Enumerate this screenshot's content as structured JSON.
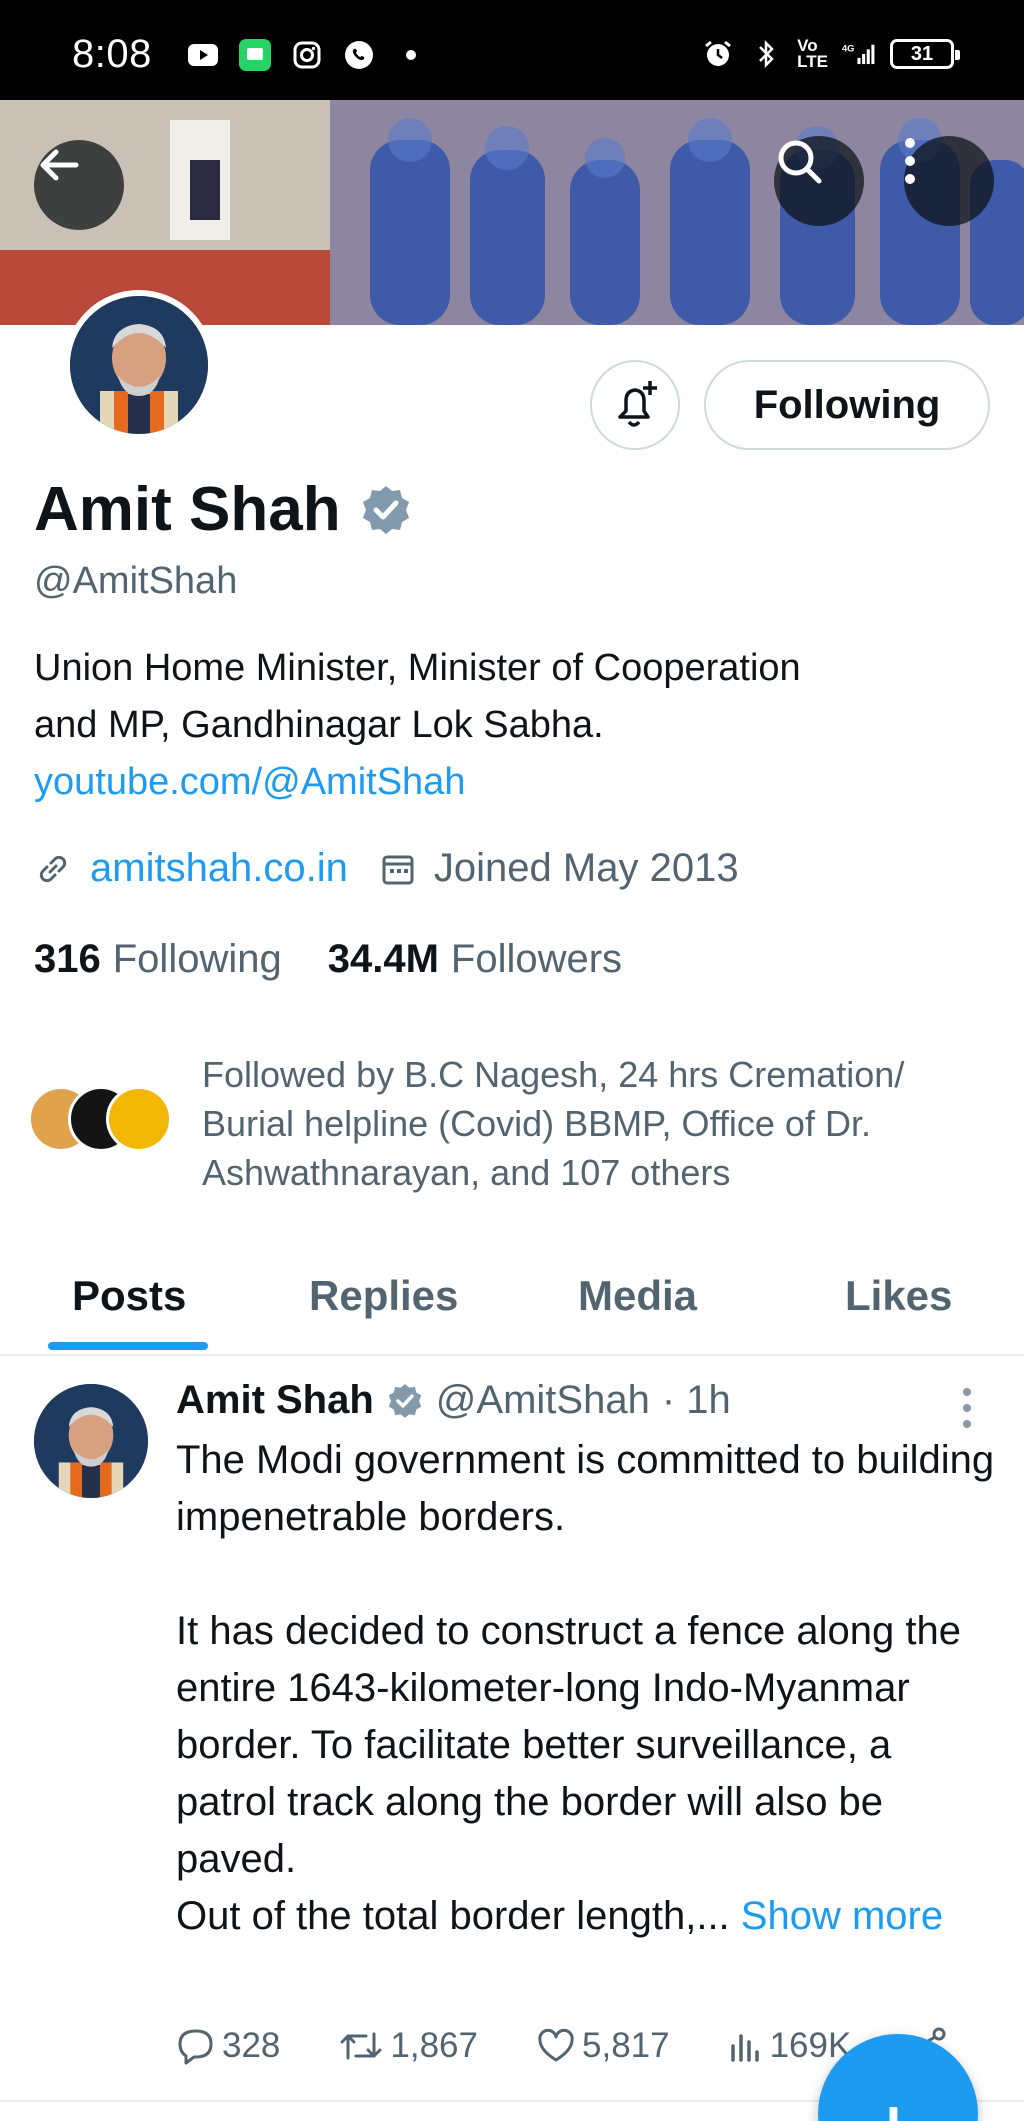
{
  "status_bar": {
    "time": "8:08",
    "battery": "31"
  },
  "header": {
    "back_icon": "arrow-left-icon",
    "search_icon": "search-icon",
    "more_icon": "more-vertical-icon"
  },
  "profile": {
    "name": "Amit Shah",
    "handle": "@AmitShah",
    "verified": true,
    "following_button": "Following",
    "bio_line1": "Union Home Minister, Minister of Cooperation",
    "bio_line2": "and MP, Gandhinagar Lok Sabha.",
    "bio_link": "youtube.com/@AmitShah",
    "website": "amitshah.co.in",
    "joined": "Joined May 2013",
    "following_count": "316",
    "following_label": "Following",
    "followers_count": "34.4M",
    "followers_label": "Followers",
    "followed_by": "Followed by B.C Nagesh, 24 hrs Cremation/ Burial helpline (Covid) BBMP, Office of Dr. Ashwathnarayan, and 107 others"
  },
  "tabs": [
    "Posts",
    "Replies",
    "Media",
    "Likes"
  ],
  "post": {
    "name": "Amit Shah",
    "handle": "@AmitShah",
    "time": "· 1h",
    "text": "The Modi government is committed to building impenetrable borders.\n\nIt has decided to construct a fence along the entire 1643-kilometer-long Indo-Myanmar border. To facilitate better surveillance, a patrol track along the border will also be paved.\nOut of the total border length,... ",
    "show_more": "Show more",
    "replies": "328",
    "reposts": "1,867",
    "likes": "5,817",
    "views": "169K"
  },
  "colors": {
    "accent": "#1d9bf0",
    "text": "#0f1419",
    "secondary": "#536471",
    "verified": "#829aab"
  }
}
